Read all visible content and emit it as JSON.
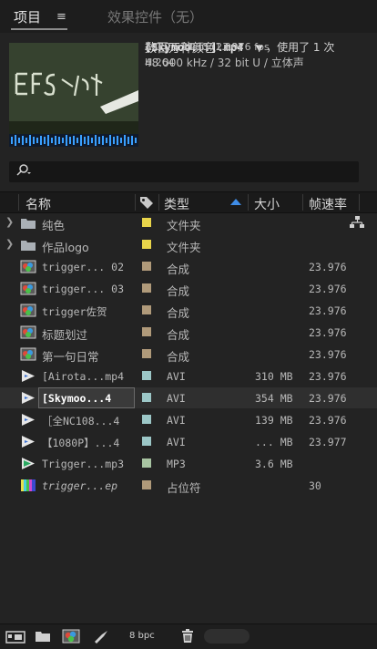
{
  "tabs": {
    "project": "项目",
    "effects": "效果控件（无）"
  },
  "preview": {
    "file_title": "[Skymoo...].mp4",
    "used_label": "，使用了 1 次",
    "resolution": "1920 x 1080 (1.00)",
    "duration": "Δ 0:23:38:15, 23.976 fps",
    "colors": "数百万种颜色",
    "codec": "H.264",
    "audio": "48.000 kHz / 32 bit U / 立体声"
  },
  "search": {
    "icon": "search-icon"
  },
  "columns": {
    "name": "名称",
    "type": "类型",
    "size": "大小",
    "fps": "帧速率"
  },
  "colors": {
    "yellow": "#e8d44a",
    "tan": "#b09a7a",
    "teal": "#9cc7c7",
    "sage": "#a8c4a2",
    "bg": "#232323",
    "accent": "#3f8ce6"
  },
  "items": [
    {
      "name": "纯色",
      "type": "文件夹",
      "size": "",
      "fps": "",
      "icon": "folder-icon",
      "label": "yellow"
    },
    {
      "name": "作品logo",
      "type": "文件夹",
      "size": "",
      "fps": "",
      "icon": "folder-icon",
      "label": "yellow"
    },
    {
      "name": "trigger... 02",
      "type": "合成",
      "size": "",
      "fps": "23.976",
      "icon": "composition-icon",
      "label": "tan"
    },
    {
      "name": "trigger... 03",
      "type": "合成",
      "size": "",
      "fps": "23.976",
      "icon": "composition-icon",
      "label": "tan"
    },
    {
      "name": "trigger佐贺",
      "type": "合成",
      "size": "",
      "fps": "23.976",
      "icon": "composition-icon",
      "label": "tan"
    },
    {
      "name": "标题划过",
      "type": "合成",
      "size": "",
      "fps": "23.976",
      "icon": "composition-icon",
      "label": "tan"
    },
    {
      "name": "第一句日常",
      "type": "合成",
      "size": "",
      "fps": "23.976",
      "icon": "composition-icon",
      "label": "tan"
    },
    {
      "name": "[Airota...mp4",
      "type": "AVI",
      "size": "310 MB",
      "fps": "23.976",
      "icon": "video-footage-icon",
      "label": "teal"
    },
    {
      "name": "[Skymoo...4",
      "type": "AVI",
      "size": "354 MB",
      "fps": "23.976",
      "icon": "video-footage-icon",
      "label": "teal"
    },
    {
      "name": "［全NC108...4",
      "type": "AVI",
      "size": "139 MB",
      "fps": "23.976",
      "icon": "video-footage-icon",
      "label": "teal"
    },
    {
      "name": "【1080P】...4",
      "type": "AVI",
      "size": "... MB",
      "fps": "23.977",
      "icon": "video-footage-icon",
      "label": "teal"
    },
    {
      "name": "Trigger...mp3",
      "type": "MP3",
      "size": "3.6 MB",
      "fps": "",
      "icon": "audio-footage-icon",
      "label": "sage"
    },
    {
      "name": "trigger...ep",
      "type": "占位符",
      "size": "",
      "fps": "30",
      "icon": "placeholder-icon",
      "label": "tan"
    }
  ],
  "footer": {
    "bpc": "8 bpc"
  }
}
